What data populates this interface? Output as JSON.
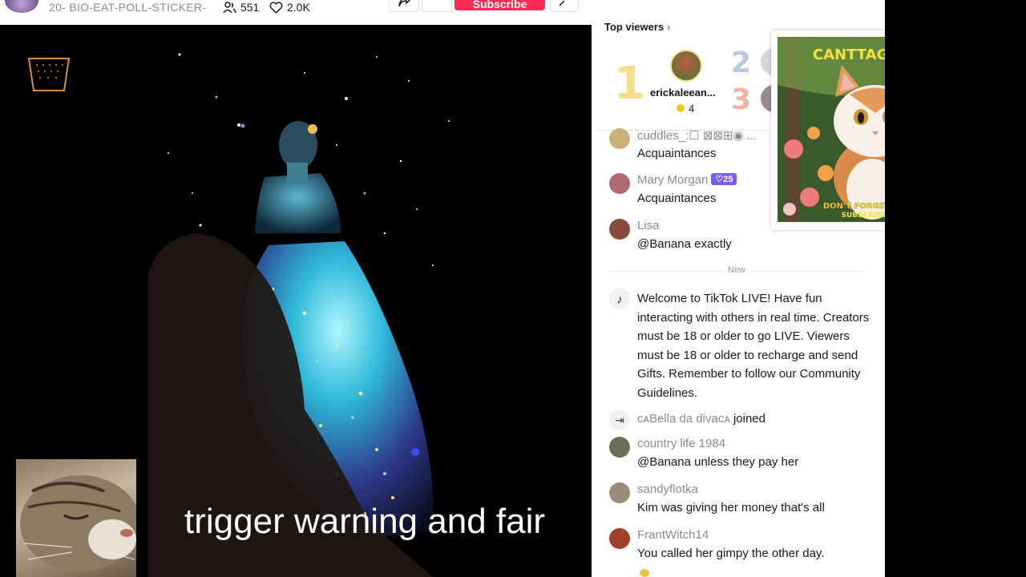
{
  "stream": {
    "title": "20- BIO-EAT-POLL-STICKER-",
    "viewer_count": "551",
    "like_count": "2.0K",
    "subscribe_label": "Subscribe"
  },
  "caption": "trigger warning and fair",
  "top_viewers": {
    "heading": "Top viewers",
    "ranks": [
      "1",
      "2",
      "3"
    ],
    "first": {
      "name": "erickaleean...",
      "coins": "4"
    }
  },
  "cat_card": {
    "headline": "CANTTAGUCCI",
    "footer_line1": "DON'T FORGET TO",
    "footer_line2": "SUBSCRIBE"
  },
  "chat": {
    "messages_before": [
      {
        "user": "cuddles_:☐ ⊠⊠⊞◉ ...",
        "text": "Acquaintances",
        "avatar_color": "#c9b27a",
        "badge": ""
      },
      {
        "user": "Mary Morgan",
        "text": "Acquaintances",
        "avatar_color": "#b06a70",
        "badge": "25"
      },
      {
        "user": "Lisa",
        "text": "@Banana exactly",
        "avatar_color": "#8a4a3a",
        "badge": ""
      }
    ],
    "new_label": "New",
    "welcome": "Welcome to TikTok LIVE! Have fun interacting with others in real time. Creators must be 18 or older to go LIVE. Viewers must be 18 or older to recharge and send Gifts. Remember to follow our Community Guidelines.",
    "join": {
      "user": "ᴄᴀBella da divaᴄᴀ",
      "action": "joined"
    },
    "messages_after": [
      {
        "user": "country life 1984",
        "text": "@Banana unless they pay her",
        "avatar_color": "#6b6f5a"
      },
      {
        "user": "sandyflotka",
        "text": "Kim was giving her money that's all",
        "avatar_color": "#9a8c78"
      },
      {
        "user": "FrantWitch14",
        "text": "You called her gimpy the other day.",
        "avatar_color": "#a0412a"
      }
    ]
  },
  "colors": {
    "subscribe": "#fe2c55",
    "badge": "#7b5cf0",
    "rank1": "#f7dc8c",
    "rank2": "#b9c7df",
    "rank3": "#f0b4a0"
  }
}
